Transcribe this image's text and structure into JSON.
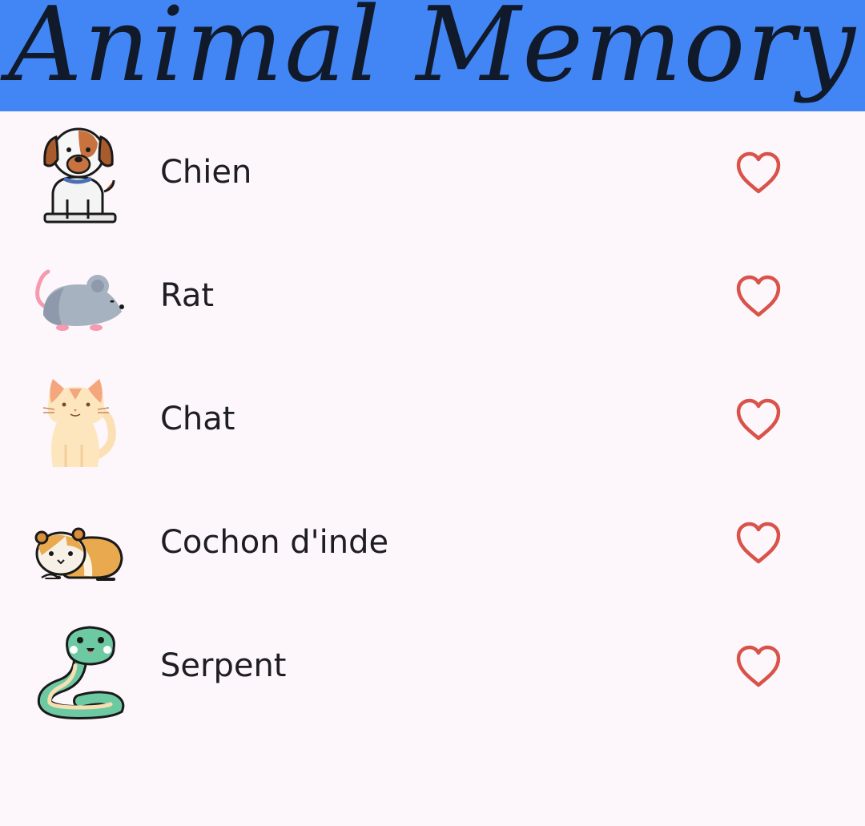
{
  "app_bar": {
    "title": "Animal Memory",
    "color": "#4286F5"
  },
  "animals": [
    {
      "name": "Chien",
      "icon": "dog-icon",
      "favorite": false
    },
    {
      "name": "Rat",
      "icon": "rat-icon",
      "favorite": false
    },
    {
      "name": "Chat",
      "icon": "cat-icon",
      "favorite": false
    },
    {
      "name": "Cochon d'inde",
      "icon": "guinea-pig-icon",
      "favorite": false
    },
    {
      "name": "Serpent",
      "icon": "snake-icon",
      "favorite": false
    }
  ],
  "colors": {
    "background": "#FDF7FC",
    "heart": "#D9534A",
    "text": "#1E1D22"
  }
}
